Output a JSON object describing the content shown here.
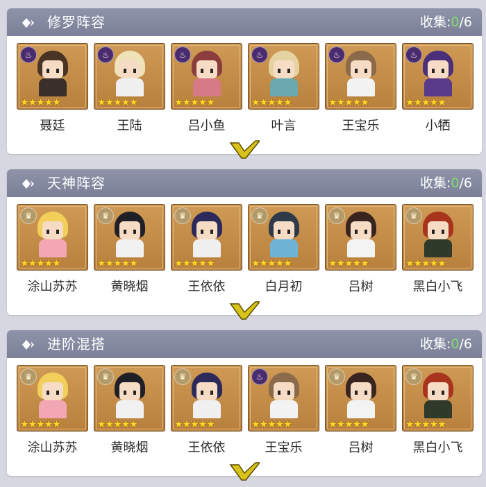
{
  "sections": [
    {
      "title": "修罗阵容",
      "collect_label": "收集:",
      "collected": "0",
      "total": "/6",
      "characters": [
        {
          "name": "聂廷",
          "badge": "fire",
          "stars": "★★★★★",
          "hair": "#4a3426",
          "body": "#3a2f2a"
        },
        {
          "name": "王陆",
          "badge": "fire",
          "stars": "★★★★★",
          "hair": "#efe2b8",
          "body": "#f0f0f0"
        },
        {
          "name": "吕小鱼",
          "badge": "fire",
          "stars": "★★★★★",
          "hair": "#8b3d3d",
          "body": "#d57a86"
        },
        {
          "name": "叶言",
          "badge": "fire",
          "stars": "★★★★★",
          "hair": "#e4d3a0",
          "body": "#6aa9b0"
        },
        {
          "name": "王宝乐",
          "badge": "fire",
          "stars": "★★★★★",
          "hair": "#8a6a4a",
          "body": "#f2f2f2"
        },
        {
          "name": "小牺",
          "badge": "fire",
          "stars": "★★★★★",
          "hair": "#4b2f7a",
          "body": "#5a3a8a"
        }
      ]
    },
    {
      "title": "天神阵容",
      "collect_label": "收集:",
      "collected": "0",
      "total": "/6",
      "characters": [
        {
          "name": "涂山苏苏",
          "badge": "crown",
          "stars": "★★★★★",
          "hair": "#f2cf5a",
          "body": "#f3a7b4"
        },
        {
          "name": "黄晓烟",
          "badge": "crown",
          "stars": "★★★★★",
          "hair": "#1f1f26",
          "body": "#f1f1f1"
        },
        {
          "name": "王依依",
          "badge": "crown",
          "stars": "★★★★★",
          "hair": "#2c2a5a",
          "body": "#f0f0f0"
        },
        {
          "name": "白月初",
          "badge": "crown",
          "stars": "★★★★★",
          "hair": "#2e3a4a",
          "body": "#6fb3d6"
        },
        {
          "name": "吕树",
          "badge": "crown",
          "stars": "★★★★★",
          "hair": "#3a2420",
          "body": "#f3f3f3"
        },
        {
          "name": "黑白小飞",
          "badge": "crown",
          "stars": "★★★★★",
          "hair": "#a8341e",
          "body": "#2f3a2a"
        }
      ]
    },
    {
      "title": "进阶混搭",
      "collect_label": "收集:",
      "collected": "0",
      "total": "/6",
      "characters": [
        {
          "name": "涂山苏苏",
          "badge": "crown",
          "stars": "★★★★★",
          "hair": "#f2cf5a",
          "body": "#f3a7b4"
        },
        {
          "name": "黄晓烟",
          "badge": "crown",
          "stars": "★★★★★",
          "hair": "#1f1f26",
          "body": "#f1f1f1"
        },
        {
          "name": "王依依",
          "badge": "crown",
          "stars": "★★★★★",
          "hair": "#2c2a5a",
          "body": "#f0f0f0"
        },
        {
          "name": "王宝乐",
          "badge": "fire",
          "stars": "★★★★★",
          "hair": "#8a6a4a",
          "body": "#f2f2f2"
        },
        {
          "name": "吕树",
          "badge": "crown",
          "stars": "★★★★★",
          "hair": "#3a2420",
          "body": "#f3f3f3"
        },
        {
          "name": "黑白小飞",
          "badge": "crown",
          "stars": "★★★★★",
          "hair": "#a8341e",
          "body": "#2f3a2a"
        }
      ]
    }
  ],
  "colors": {
    "header": "#8088a0",
    "collected_count": "#7fe06a",
    "card_bg": "#c48d48",
    "star": "#ffd52a",
    "chevron": "#d9c31a"
  }
}
